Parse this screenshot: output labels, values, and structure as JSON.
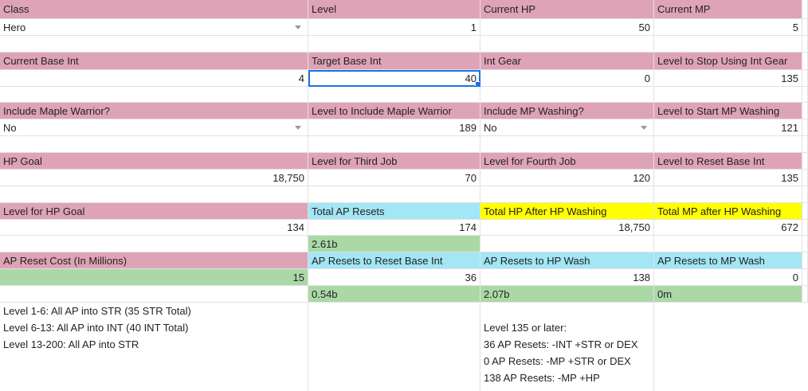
{
  "row1": {
    "labels": [
      "Class",
      "Level",
      "Current HP",
      "Current MP"
    ],
    "class": "Hero",
    "level": "1",
    "hp": "50",
    "mp": "5"
  },
  "row2": {
    "labels": [
      "Current Base Int",
      "Target Base Int",
      "Int Gear",
      "Level to Stop Using Int Gear"
    ],
    "values": [
      "4",
      "40",
      "0",
      "135"
    ]
  },
  "row3": {
    "labels": [
      "Include Maple Warrior?",
      "Level to Include Maple Warrior",
      "Include MP Washing?",
      "Level to Start MP Washing"
    ],
    "maple": "No",
    "maple_level": "189",
    "mp_wash": "No",
    "mp_wash_level": "121"
  },
  "row4": {
    "labels": [
      "HP Goal",
      "Level for Third Job",
      "Level for Fourth Job",
      "Level to Reset Base Int"
    ],
    "values": [
      "18,750",
      "70",
      "120",
      "135"
    ]
  },
  "row5": {
    "labels": [
      "Level for HP Goal",
      "Total AP Resets",
      "Total HP After HP Washing",
      "Total MP after HP Washing"
    ],
    "values": [
      "134",
      "174",
      "18,750",
      "672"
    ],
    "cost_total": "2.61b"
  },
  "row6": {
    "labels": [
      "AP Reset Cost (In Millions)",
      "AP Resets to Reset Base Int",
      "AP Resets to HP Wash",
      "AP Resets to MP Wash"
    ],
    "values": [
      "15",
      "36",
      "138",
      "0"
    ],
    "costs": [
      "0.54b",
      "2.07b",
      "0m"
    ]
  },
  "notes_left": [
    "Level 1-6: All AP into STR (35 STR Total)",
    "Level 6-13: All AP into INT (40 INT Total)",
    "Level 13-200: All AP into STR"
  ],
  "notes_right": [
    "Level 135 or later:",
    "36 AP Resets: -INT +STR or DEX",
    "0 AP Resets: -MP +STR or DEX",
    "138 AP Resets: -MP +HP"
  ],
  "colors": {
    "header": "#dfa3b8",
    "computed": "#aad9a6",
    "resets": "#a3e6f5",
    "highlight": "#ffff00",
    "selection": "#1a73e8"
  }
}
